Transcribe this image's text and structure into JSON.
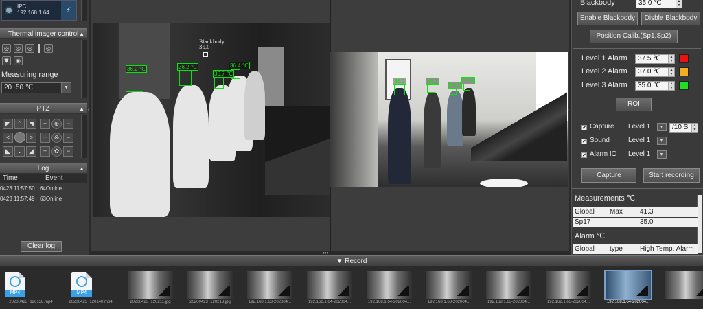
{
  "device": {
    "name": "IPC",
    "ip": "192.168.1.64"
  },
  "thermal_control": {
    "title": "Thermal imager control",
    "measuring_range_label": "Measuring range",
    "measuring_range_value": "20~50 ℃"
  },
  "ptz": {
    "title": "PTZ"
  },
  "log": {
    "title": "Log",
    "col_time": "Time",
    "col_event": "Event",
    "rows": [
      {
        "time": "0423 11:57:50",
        "event": "64Online"
      },
      {
        "time": "0423 11:57:49",
        "event": "63Online"
      }
    ],
    "clear_label": "Clear log"
  },
  "thermal_view": {
    "blackbody_label": "Blackbody",
    "blackbody_temp": "35.0",
    "faces": [
      "36.2 ℃",
      "36.2 ℃",
      "36.7 ℃",
      "36.4 ℃"
    ]
  },
  "visible_view": {
    "faces": [
      "36.2",
      "36.2",
      "36.2",
      "36.4"
    ]
  },
  "right": {
    "blackbody_label": "Blackbody",
    "blackbody_value": "35.0 ℃",
    "enable_blackbody": "Enable Blackbody",
    "disable_blackbody": "Disble Blackbody",
    "position_calib": "Position Calib.(Sp1,Sp2)",
    "alarms": [
      {
        "label": "Level 1 Alarm",
        "value": "37.5 ℃",
        "color": "#ee1111"
      },
      {
        "label": "Level 2 Alarm",
        "value": "37.0 ℃",
        "color": "#f2b01e"
      },
      {
        "label": "Level 3 Alarm",
        "value": "35.0 ℃",
        "color": "#22dd22"
      }
    ],
    "roi": "ROI",
    "actions": [
      {
        "label": "Capture",
        "level": "Level 1",
        "extra": "/10 S"
      },
      {
        "label": "Sound",
        "level": "Level 1"
      },
      {
        "label": "Alarm IO",
        "level": "Level 1"
      }
    ],
    "capture_button": "Capture",
    "record_button": "Start recording"
  },
  "measurements": {
    "title": "Measurements ℃",
    "rows": [
      {
        "a": "Global",
        "b": "Max",
        "c": "41.3"
      },
      {
        "a": "Sp17",
        "b": "",
        "c": "35.0"
      }
    ],
    "alarm_title": "Alarm ℃",
    "alarm_row": {
      "a": "Global",
      "b": "type",
      "c": "High Temp. Alarm"
    }
  },
  "record": {
    "title": "Record",
    "files": [
      {
        "kind": "mp4",
        "label": "MP4",
        "caption": "20200423_120138.mp4"
      },
      {
        "kind": "mp4",
        "label": "MP4",
        "caption": "20200423_120140.mp4"
      },
      {
        "kind": "img",
        "caption": "20200423_120211.jpg"
      },
      {
        "kind": "img",
        "caption": "20200423_120213.jpg"
      },
      {
        "kind": "img",
        "caption": "192.168.1.63-202004..."
      },
      {
        "kind": "img",
        "caption": "192.168.1.64-202004..."
      },
      {
        "kind": "img",
        "caption": "192.168.1.64-202004..."
      },
      {
        "kind": "img",
        "caption": "192.168.1.63-202004..."
      },
      {
        "kind": "img",
        "caption": "192.168.1.63-202004..."
      },
      {
        "kind": "img",
        "caption": "192.168.1.63-202004..."
      },
      {
        "kind": "img",
        "caption": "192.168.1.64-202004..."
      },
      {
        "kind": "img",
        "caption": ""
      }
    ]
  }
}
